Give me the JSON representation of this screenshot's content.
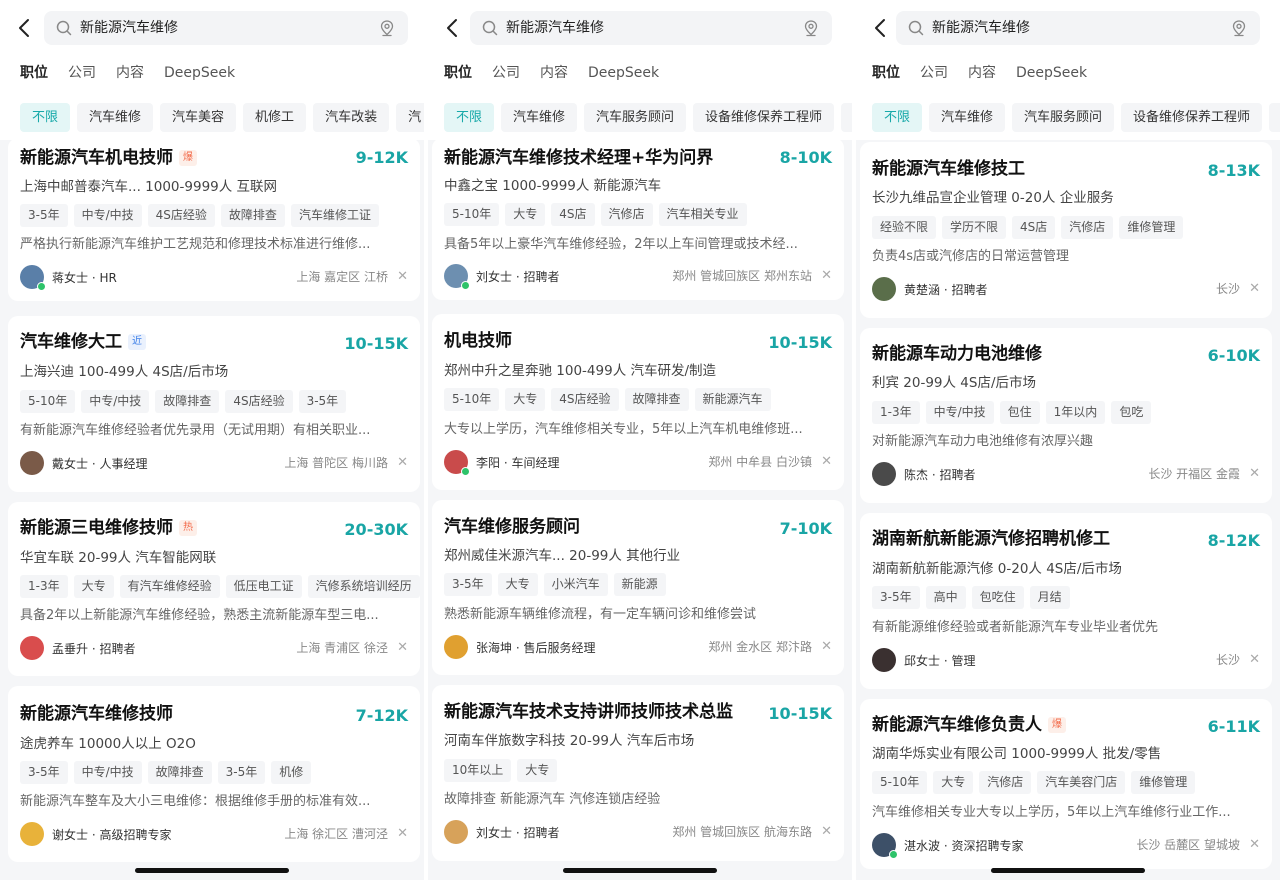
{
  "search": {
    "query": "新能源汽车维修"
  },
  "tabs": [
    "职位",
    "公司",
    "内容",
    "DeepSeek"
  ],
  "colors": {
    "accent": "#19a5a5",
    "hot": "#f36d4d",
    "near": "#3b7ee8",
    "online": "#2ec36a"
  },
  "panels": [
    {
      "filters": [
        "不限",
        "汽车维修",
        "汽车美容",
        "机修工",
        "汽车改装",
        "汽"
      ],
      "jobs": [
        {
          "title": "新能源汽车机电技师",
          "badge": "爆",
          "badge_type": "hot",
          "salary": "9-12K",
          "company": "上海中邮普泰汽车... 1000-9999人 互联网",
          "tags": [
            "3-5年",
            "中专/中技",
            "4S店经验",
            "故障排查",
            "汽车维修工证"
          ],
          "desc": "严格执行新能源汽车维护工艺规范和修理技术标准进行维修...",
          "recruiter": "蒋女士 · HR",
          "location": "上海 嘉定区 江桥",
          "online": true,
          "avatar_color": "#5a7fa8"
        },
        {
          "title": "汽车维修大工",
          "badge": "近",
          "badge_type": "near",
          "salary": "10-15K",
          "company": "上海兴迪 100-499人 4S店/后市场",
          "tags": [
            "5-10年",
            "中专/中技",
            "故障排查",
            "4S店经验",
            "3-5年"
          ],
          "desc": "有新能源汽车维修经验者优先录用（无试用期）有相关职业...",
          "recruiter": "戴女士 · 人事经理",
          "location": "上海 普陀区 梅川路",
          "online": false,
          "avatar_color": "#7a5a48"
        },
        {
          "title": "新能源三电维修技师",
          "badge": "热",
          "badge_type": "hot",
          "salary": "20-30K",
          "company": "华宜车联 20-99人 汽车智能网联",
          "tags": [
            "1-3年",
            "大专",
            "有汽车维修经验",
            "低压电工证",
            "汽修系统培训经历"
          ],
          "desc": "具备2年以上新能源汽车维修经验，熟悉主流新能源车型三电...",
          "recruiter": "孟垂升 · 招聘者",
          "location": "上海 青浦区 徐泾",
          "online": false,
          "avatar_color": "#d94d4d"
        },
        {
          "title": "新能源汽车维修技师",
          "badge": "",
          "badge_type": "",
          "salary": "7-12K",
          "company": "途虎养车 10000人以上 O2O",
          "tags": [
            "3-5年",
            "中专/中技",
            "故障排查",
            "3-5年",
            "机修"
          ],
          "desc": "新能源汽车整车及大小三电维修：根据维修手册的标准有效...",
          "recruiter": "谢女士 · 高级招聘专家",
          "location": "上海 徐汇区 漕河泾",
          "online": false,
          "avatar_color": "#e8b23a"
        }
      ]
    },
    {
      "filters": [
        "不限",
        "汽车维修",
        "汽车服务顾问",
        "设备维修保养工程师",
        ""
      ],
      "jobs": [
        {
          "title": "新能源汽车维修技术经理+华为问界",
          "badge": "",
          "badge_type": "",
          "salary": "8-10K",
          "company": "中鑫之宝 1000-9999人 新能源汽车",
          "tags": [
            "5-10年",
            "大专",
            "4S店",
            "汽修店",
            "汽车相关专业"
          ],
          "desc": "具备5年以上豪华汽车维修经验，2年以上车间管理或技术经...",
          "recruiter": "刘女士 · 招聘者",
          "location": "郑州 管城回族区 郑州东站",
          "online": true,
          "avatar_color": "#6d8fb0"
        },
        {
          "title": "机电技师",
          "badge": "",
          "badge_type": "",
          "salary": "10-15K",
          "company": "郑州中升之星奔驰 100-499人 汽车研发/制造",
          "tags": [
            "5-10年",
            "大专",
            "4S店经验",
            "故障排查",
            "新能源汽车"
          ],
          "desc": "大专以上学历，汽车维修相关专业，5年以上汽车机电维修班...",
          "recruiter": "李阳 · 车间经理",
          "location": "郑州 中牟县 白沙镇",
          "online": true,
          "avatar_color": "#c94b4b"
        },
        {
          "title": "汽车维修服务顾问",
          "badge": "",
          "badge_type": "",
          "salary": "7-10K",
          "company": "郑州威佳米源汽车... 20-99人 其他行业",
          "tags": [
            "3-5年",
            "大专",
            "小米汽车",
            "新能源"
          ],
          "desc": "熟悉新能源车辆维修流程，有一定车辆问诊和维修尝试",
          "recruiter": "张海坤 · 售后服务经理",
          "location": "郑州 金水区 郑汴路",
          "online": false,
          "avatar_color": "#e0a030"
        },
        {
          "title": "新能源汽车技术支持讲师技师技术总监",
          "badge": "",
          "badge_type": "",
          "salary": "10-15K",
          "company": "河南车伴旅数字科技 20-99人 汽车后市场",
          "tags": [
            "10年以上",
            "大专"
          ],
          "desc": "故障排查  新能源汽车  汽修连锁店经验",
          "recruiter": "刘女士 · 招聘者",
          "location": "郑州 管城回族区 航海东路",
          "online": false,
          "avatar_color": "#d7a25a"
        }
      ]
    },
    {
      "filters": [
        "不限",
        "汽车维修",
        "汽车服务顾问",
        "设备维修保养工程师",
        ""
      ],
      "jobs": [
        {
          "title": "新能源汽车维修技工",
          "badge": "",
          "badge_type": "",
          "salary": "8-13K",
          "company": "长沙九维品宣企业管理 0-20人 企业服务",
          "tags": [
            "经验不限",
            "学历不限",
            "4S店",
            "汽修店",
            "维修管理"
          ],
          "desc": "负责4s店或汽修店的日常运营管理",
          "recruiter": "黄楚涵 · 招聘者",
          "location": "长沙",
          "online": false,
          "avatar_color": "#5a6e4a"
        },
        {
          "title": "新能源车动力电池维修",
          "badge": "",
          "badge_type": "",
          "salary": "6-10K",
          "company": "利宾 20-99人 4S店/后市场",
          "tags": [
            "1-3年",
            "中专/中技",
            "包住",
            "1年以内",
            "包吃"
          ],
          "desc": "对新能源汽车动力电池维修有浓厚兴趣",
          "recruiter": "陈杰 · 招聘者",
          "location": "长沙 开福区 金霞",
          "online": false,
          "avatar_color": "#4a4a4a"
        },
        {
          "title": "湖南新航新能源汽修招聘机修工",
          "badge": "",
          "badge_type": "",
          "salary": "8-12K",
          "company": "湖南新航新能源汽修 0-20人 4S店/后市场",
          "tags": [
            "3-5年",
            "高中",
            "包吃住",
            "月结"
          ],
          "desc": "有新能源维修经验或者新能源汽车专业毕业者优先",
          "recruiter": "邱女士 · 管理",
          "location": "长沙",
          "online": false,
          "avatar_color": "#3a3030"
        },
        {
          "title": "新能源汽车维修负责人",
          "badge": "爆",
          "badge_type": "hot",
          "salary": "6-11K",
          "company": "湖南华烁实业有限公司 1000-9999人 批发/零售",
          "tags": [
            "5-10年",
            "大专",
            "汽修店",
            "汽车美容门店",
            "维修管理"
          ],
          "desc": "汽车维修相关专业大专以上学历，5年以上汽车维修行业工作...",
          "recruiter": "湛水波 · 资深招聘专家",
          "location": "长沙 岳麓区 望城坡",
          "online": true,
          "avatar_color": "#3d5068"
        }
      ]
    }
  ]
}
